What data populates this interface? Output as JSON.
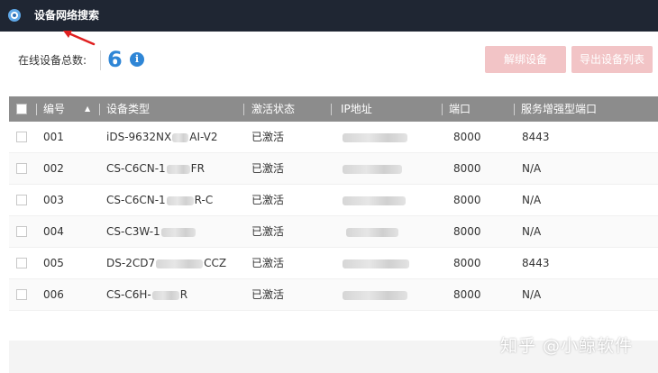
{
  "window": {
    "title": "设备网络搜索"
  },
  "toolbar": {
    "total_label": "在线设备总数:",
    "total_count": "6",
    "info_icon": "i",
    "unbind_button": "解绑设备",
    "export_button": "导出设备列表"
  },
  "table": {
    "headers": [
      "编号",
      "设备类型",
      "激活状态",
      "IP地址",
      "端口",
      "服务增强型端口"
    ],
    "rows": [
      {
        "id": "001",
        "type": "iDS-9632NX",
        "type_suffix": "AI-V2",
        "status": "已激活",
        "port": "8000",
        "enh_port": "8443"
      },
      {
        "id": "002",
        "type": "CS-C6CN-1",
        "type_suffix": "FR",
        "status": "已激活",
        "port": "8000",
        "enh_port": "N/A"
      },
      {
        "id": "003",
        "type": "CS-C6CN-1",
        "type_suffix": "R-C",
        "status": "已激活",
        "port": "8000",
        "enh_port": "N/A"
      },
      {
        "id": "004",
        "type": "CS-C3W-1",
        "type_suffix": "",
        "status": "已激活",
        "port": "8000",
        "enh_port": "N/A"
      },
      {
        "id": "005",
        "type": "DS-2CD7",
        "type_suffix": "CCZ",
        "status": "已激活",
        "port": "8000",
        "enh_port": "8443"
      },
      {
        "id": "006",
        "type": "CS-C6H-",
        "type_suffix": "R",
        "status": "已激活",
        "port": "8000",
        "enh_port": "N/A"
      }
    ]
  },
  "watermark": "知乎 @小鲸软件",
  "colors": {
    "titlebar": "#1f2633",
    "accent": "#2f86d6",
    "button_disabled": "#f2c4c6",
    "header_bg": "#8c8c8c",
    "annotation": "#e02020"
  }
}
